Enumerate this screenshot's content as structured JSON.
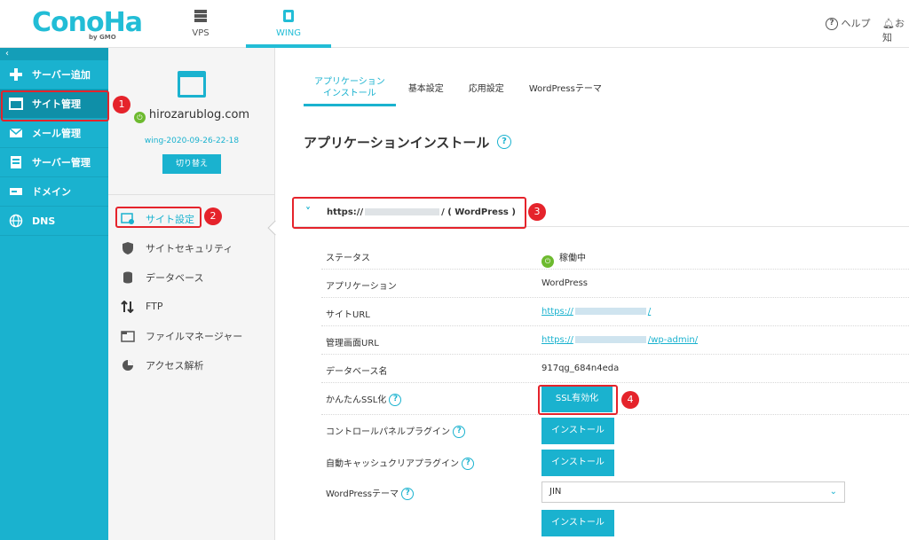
{
  "header": {
    "logo": "ConoHa",
    "logo_sub": "by GMO",
    "nav": [
      {
        "label": "VPS"
      },
      {
        "label": "WING"
      }
    ],
    "help_label": "ヘルプ",
    "notice_label": "お知"
  },
  "sidebar": {
    "collapse_icon": "‹",
    "items": [
      {
        "label": "サーバー追加",
        "icon": "plus-icon"
      },
      {
        "label": "サイト管理",
        "icon": "window-icon"
      },
      {
        "label": "メール管理",
        "icon": "mail-icon"
      },
      {
        "label": "サーバー管理",
        "icon": "server-icon"
      },
      {
        "label": "ドメイン",
        "icon": "domain-icon"
      },
      {
        "label": "DNS",
        "icon": "globe-icon"
      }
    ]
  },
  "subpanel": {
    "domain": "hirozarublog.com",
    "wing_id": "wing-2020-09-26-22-18",
    "switch_label": "切り替え",
    "menu": [
      {
        "label": "サイト設定",
        "icon": "site-settings-icon"
      },
      {
        "label": "サイトセキュリティ",
        "icon": "shield-icon"
      },
      {
        "label": "データベース",
        "icon": "database-icon"
      },
      {
        "label": "FTP",
        "icon": "ftp-icon"
      },
      {
        "label": "ファイルマネージャー",
        "icon": "folder-icon"
      },
      {
        "label": "アクセス解析",
        "icon": "pie-chart-icon"
      }
    ]
  },
  "main": {
    "tabs": [
      {
        "label": "アプリケーション\nインストール"
      },
      {
        "label": "基本設定"
      },
      {
        "label": "応用設定"
      },
      {
        "label": "WordPressテーマ"
      }
    ],
    "page_title": "アプリケーションインストール",
    "site": {
      "url_prefix": "https://",
      "url_suffix": "/ ( WordPress )"
    },
    "details": {
      "status_label": "ステータス",
      "status_value": "稼働中",
      "app_label": "アプリケーション",
      "app_value": "WordPress",
      "site_url_label": "サイトURL",
      "site_url_prefix": "https://",
      "site_url_suffix": "/",
      "admin_url_label": "管理画面URL",
      "admin_url_prefix": "https://",
      "admin_url_suffix": "/wp-admin/",
      "db_label": "データベース名",
      "db_value": "917qg_684n4eda",
      "ssl_label": "かんたんSSL化",
      "ssl_button": "SSL有効化",
      "cp_plugin_label": "コントロールパネルプラグイン",
      "cp_plugin_button": "インストール",
      "cache_plugin_label": "自動キャッシュクリアプラグイン",
      "cache_plugin_button": "インストール",
      "theme_label": "WordPressテーマ",
      "theme_value": "JIN",
      "theme_button": "インストール"
    }
  },
  "annotations": [
    "1",
    "2",
    "3",
    "4"
  ],
  "colors": {
    "accent": "#1ab2cf",
    "annotation": "#e5232b",
    "power": "#6dba2f"
  }
}
